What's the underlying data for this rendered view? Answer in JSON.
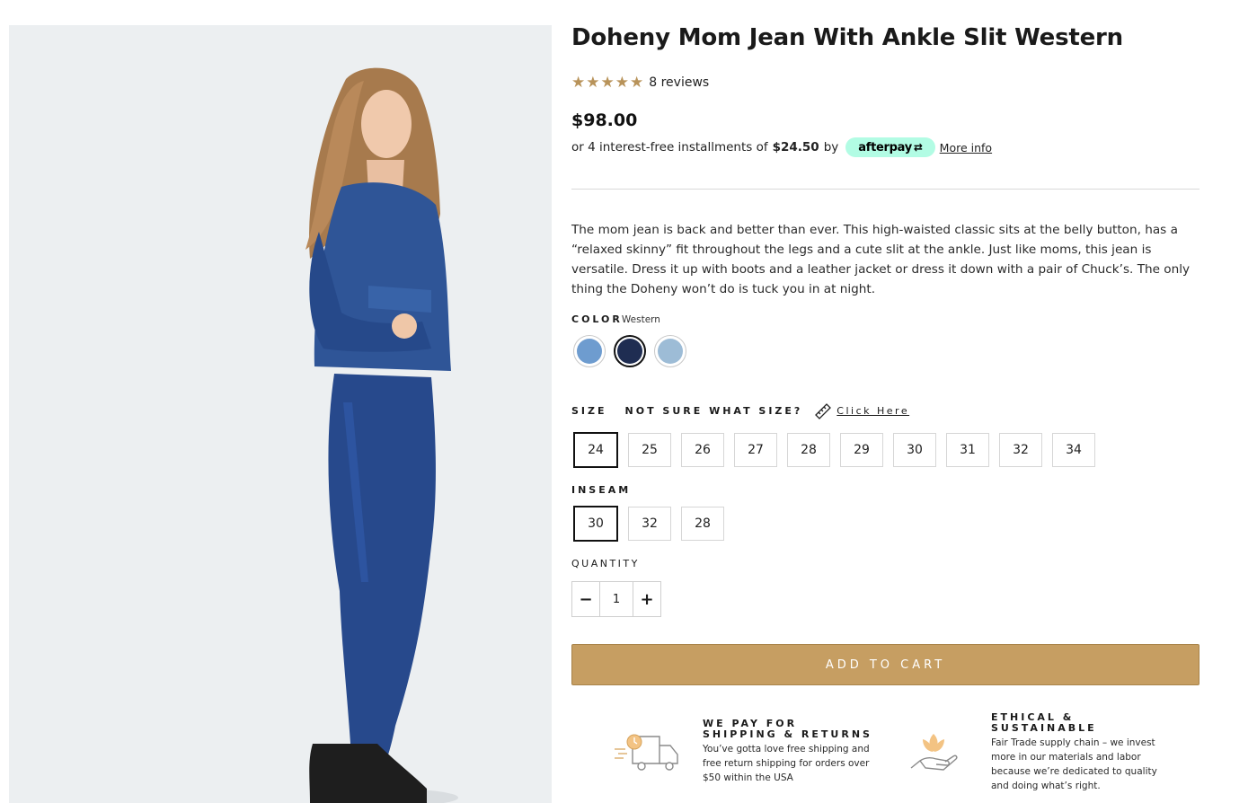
{
  "product": {
    "title": "Doheny Mom Jean With Ankle Slit Western",
    "rating_stars": 5,
    "reviews_label": "8 reviews",
    "price": "$98.00",
    "installments_prefix": "or 4 interest-free installments of",
    "installment_amount": "$24.50",
    "installments_by": "by",
    "afterpay_label": "afterpay",
    "more_info_label": "More info",
    "description": "The mom jean is back and better than ever. This high-waisted classic sits at the belly button, has a “relaxed skinny” fit throughout the legs and a cute slit at the ankle. Just like moms, this jean is versatile. Dress it up with boots and a leather jacket or dress it down with a pair of Chuck’s. The only thing the Doheny won’t do is tuck you in at night."
  },
  "color": {
    "label": "COLOR",
    "selected": "Western",
    "swatches": [
      {
        "color": "#6e9ccf",
        "selected": false
      },
      {
        "color": "#1f2d52",
        "selected": true
      },
      {
        "color": "#9dbcd6",
        "selected": false
      }
    ]
  },
  "size": {
    "label": "SIZE",
    "help_label": "NOT SURE WHAT SIZE?",
    "click_here_label": "Click Here",
    "options": [
      "24",
      "25",
      "26",
      "27",
      "28",
      "29",
      "30",
      "31",
      "32",
      "34"
    ],
    "selected": "24"
  },
  "inseam": {
    "label": "INSEAM",
    "options": [
      "30",
      "32",
      "28"
    ],
    "selected": "30"
  },
  "quantity": {
    "label": "QUANTITY",
    "minus": "−",
    "value": "1",
    "plus": "+"
  },
  "cart": {
    "add_label": "ADD TO CART"
  },
  "features": [
    {
      "icon": "truck-icon",
      "title": "WE PAY FOR SHIPPING & RETURNS",
      "text": "You’ve gotta love free shipping and free return shipping for orders over $50 within the USA"
    },
    {
      "icon": "lotus-hand-icon",
      "title": "ETHICAL & SUSTAINABLE",
      "text": "Fair Trade supply chain – we invest more in our materials and labor because we’re dedicated to quality and doing what’s right."
    }
  ],
  "theme": {
    "accent": "#c69e62",
    "star": "#b8935a",
    "afterpay_mint": "#b2fce4"
  }
}
